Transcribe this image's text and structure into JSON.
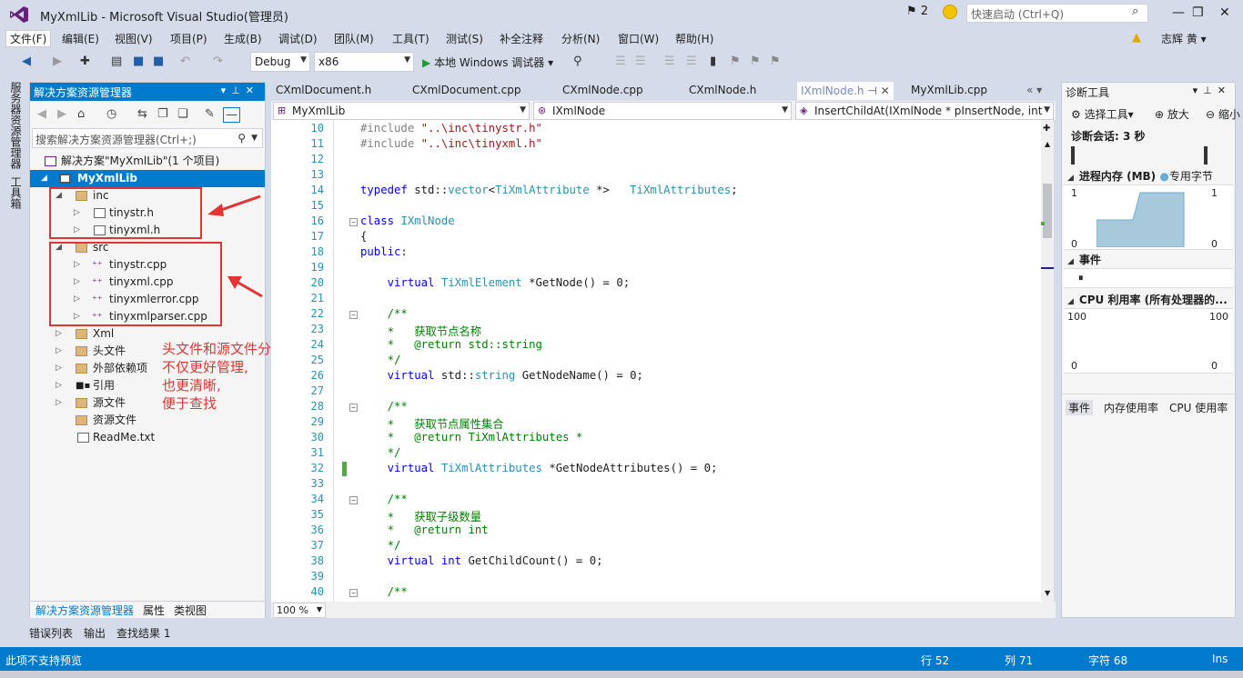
{
  "window": {
    "title": "MyXmlLib - Microsoft Visual Studio(管理员)",
    "notifications": "2",
    "quick_launch_placeholder": "快速启动 (Ctrl+Q)",
    "user": "志辉 黄"
  },
  "menu": [
    "文件(F)",
    "编辑(E)",
    "视图(V)",
    "项目(P)",
    "生成(B)",
    "调试(D)",
    "团队(M)",
    "工具(T)",
    "测试(S)",
    "补全注释",
    "分析(N)",
    "窗口(W)",
    "帮助(H)"
  ],
  "toolbar": {
    "config": "Debug",
    "platform": "x86",
    "run_label": "本地 Windows 调试器"
  },
  "left_tabs": [
    "服务器资源管理器",
    "工具箱"
  ],
  "solution_explorer": {
    "title": "解决方案资源管理器",
    "search_placeholder": "搜索解决方案资源管理器(Ctrl+;)",
    "solution": "解决方案\"MyXmlLib\"(1 个项目)",
    "project": "MyXmlLib",
    "inc_folder": "inc",
    "inc_files": [
      "tinystr.h",
      "tinyxml.h"
    ],
    "src_folder": "src",
    "src_files": [
      "tinystr.cpp",
      "tinyxml.cpp",
      "tinyxmlerror.cpp",
      "tinyxmlparser.cpp"
    ],
    "other_items": [
      "Xml",
      "头文件",
      "外部依赖项",
      "引用",
      "源文件",
      "资源文件",
      "ReadMe.txt"
    ],
    "bottom_tabs": [
      "解决方案资源管理器",
      "属性",
      "类视图"
    ]
  },
  "annotation": {
    "lines": [
      "头文件和源文件分开放,",
      "不仅更好管理,",
      "也更清晰,",
      "便于查找"
    ]
  },
  "editor": {
    "tabs": [
      "CXmlDocument.h",
      "CXmlDocument.cpp",
      "CXmlNode.cpp",
      "CXmlNode.h",
      "IXmlNode.h",
      "MyXmlLib.cpp"
    ],
    "active_tab": "IXmlNode.h",
    "nav_project": "MyXmlLib",
    "nav_class": "IXmlNode",
    "nav_member": "InsertChildAt(IXmlNode * pInsertNode, int",
    "zoom": "100 %",
    "lines": [
      {
        "n": "10",
        "t": "#include \"..\\inc\\tinystr.h\""
      },
      {
        "n": "11",
        "t": "#include \"..\\inc\\tinyxml.h\""
      },
      {
        "n": "12",
        "t": ""
      },
      {
        "n": "13",
        "t": ""
      },
      {
        "n": "14",
        "t": "typedef std::vector<TiXmlAttribute *>   TiXmlAttributes;"
      },
      {
        "n": "15",
        "t": ""
      },
      {
        "n": "16",
        "t": "class IXmlNode"
      },
      {
        "n": "17",
        "t": "{"
      },
      {
        "n": "18",
        "t": "public:"
      },
      {
        "n": "19",
        "t": ""
      },
      {
        "n": "20",
        "t": "    virtual TiXmlElement *GetNode() = 0;"
      },
      {
        "n": "21",
        "t": ""
      },
      {
        "n": "22",
        "t": "    /**"
      },
      {
        "n": "23",
        "t": "    *   获取节点名称"
      },
      {
        "n": "24",
        "t": "    *   @return std::string"
      },
      {
        "n": "25",
        "t": "    */"
      },
      {
        "n": "26",
        "t": "    virtual std::string GetNodeName() = 0;"
      },
      {
        "n": "27",
        "t": ""
      },
      {
        "n": "28",
        "t": "    /**"
      },
      {
        "n": "29",
        "t": "    *   获取节点属性集合"
      },
      {
        "n": "30",
        "t": "    *   @return TiXmlAttributes *"
      },
      {
        "n": "31",
        "t": "    */"
      },
      {
        "n": "32",
        "t": "    virtual TiXmlAttributes *GetNodeAttributes() = 0;"
      },
      {
        "n": "33",
        "t": ""
      },
      {
        "n": "34",
        "t": "    /**"
      },
      {
        "n": "35",
        "t": "    *   获取子级数量"
      },
      {
        "n": "36",
        "t": "    *   @return int"
      },
      {
        "n": "37",
        "t": "    */"
      },
      {
        "n": "38",
        "t": "    virtual int GetChildCount() = 0;"
      },
      {
        "n": "39",
        "t": ""
      },
      {
        "n": "40",
        "t": "    /**"
      }
    ]
  },
  "diagnostics": {
    "title": "诊断工具",
    "select_tool": "选择工具▾",
    "zoom_in": "放大",
    "zoom_out": "缩小",
    "session": "诊断会话: 3 秒",
    "memory_title": "进程内存 (MB)",
    "memory_legend": "专用字节",
    "memory_max": "1",
    "memory_min": "0",
    "events_title": "事件",
    "cpu_title": "CPU 利用率 (所有处理器的...",
    "cpu_max": "100",
    "cpu_min": "0",
    "bottom_tabs": [
      "事件",
      "内存使用率",
      "CPU 使用率"
    ]
  },
  "bottom_tabs": [
    "错误列表",
    "输出",
    "查找结果 1"
  ],
  "status": {
    "message": "此项不支持预览",
    "line": "行 52",
    "col": "列 71",
    "char": "字符 68",
    "mode": "Ins"
  },
  "colors": {
    "accent": "#007acc",
    "annotation": "#e53333",
    "keyword": "#0000ff",
    "type": "#2b91af",
    "comment": "#008000",
    "string": "#a31515"
  }
}
